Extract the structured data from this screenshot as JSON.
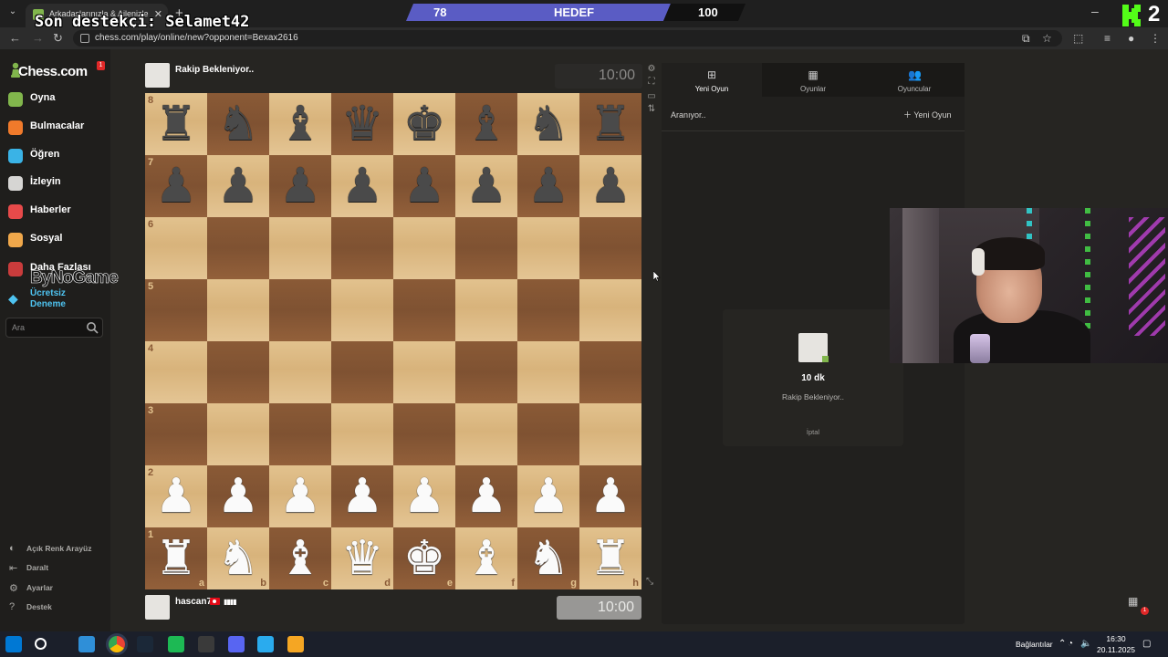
{
  "browser": {
    "tab_title": "Arkadaşlarınızla & Ailenizle Üc",
    "url": "chess.com/play/online/new?opponent=Bexax2616"
  },
  "stream_overlay": {
    "support_text": "Son destekçi: Selamet42",
    "goal_current": "78",
    "goal_label": "HEDEF",
    "goal_target": "100",
    "goal_progress": 0.78,
    "corner_number": "2"
  },
  "sidebar": {
    "logo": "Chess.com",
    "notification_count": "1",
    "items": [
      {
        "label": "Oyna",
        "icon": "pawn-play-icon",
        "color": "#81b64c"
      },
      {
        "label": "Bulmacalar",
        "icon": "puzzle-icon",
        "color": "#f07a2b"
      },
      {
        "label": "Öğren",
        "icon": "learn-icon",
        "color": "#3ab3e6"
      },
      {
        "label": "İzleyin",
        "icon": "binoculars-icon",
        "color": "#d6d5d3"
      },
      {
        "label": "Haberler",
        "icon": "news-icon",
        "color": "#e74a4a"
      },
      {
        "label": "Sosyal",
        "icon": "social-icon",
        "color": "#f0a84b"
      },
      {
        "label": "Daha Fazlası",
        "icon": "more-icon",
        "color": "#c93c3c"
      }
    ],
    "watermark": "ByNoGame",
    "trial_label": "Ücretsiz Deneme",
    "search_placeholder": "Ara",
    "bottom_items": [
      {
        "label": "Açık Renk Arayüz",
        "icon": "theme-toggle-icon"
      },
      {
        "label": "Daralt",
        "icon": "collapse-icon"
      },
      {
        "label": "Ayarlar",
        "icon": "settings-icon"
      },
      {
        "label": "Destek",
        "icon": "help-icon"
      }
    ]
  },
  "game": {
    "top_player": {
      "name": "Rakip Bekleniyor..",
      "clock": "10:00"
    },
    "bottom_player": {
      "name": "hascan7",
      "flag": "TR",
      "clock": "10:00"
    },
    "ranks": [
      "8",
      "7",
      "6",
      "5",
      "4",
      "3",
      "2",
      "1"
    ],
    "files": [
      "a",
      "b",
      "c",
      "d",
      "e",
      "f",
      "g",
      "h"
    ],
    "position": [
      [
        "br",
        "bn",
        "bb",
        "bq",
        "bk",
        "bb",
        "bn",
        "br"
      ],
      [
        "bp",
        "bp",
        "bp",
        "bp",
        "bp",
        "bp",
        "bp",
        "bp"
      ],
      [
        "",
        "",
        "",
        "",
        "",
        "",
        "",
        ""
      ],
      [
        "",
        "",
        "",
        "",
        "",
        "",
        "",
        ""
      ],
      [
        "",
        "",
        "",
        "",
        "",
        "",
        "",
        ""
      ],
      [
        "",
        "",
        "",
        "",
        "",
        "",
        "",
        ""
      ],
      [
        "wp",
        "wp",
        "wp",
        "wp",
        "wp",
        "wp",
        "wp",
        "wp"
      ],
      [
        "wr",
        "wn",
        "wb",
        "wq",
        "wk",
        "wb",
        "wn",
        "wr"
      ]
    ],
    "board_colors": {
      "light": "#dfbf8a",
      "dark": "#8a5a36"
    }
  },
  "panel": {
    "tabs": [
      {
        "label": "Yeni Oyun",
        "icon": "plus-icon",
        "active": true
      },
      {
        "label": "Oyunlar",
        "icon": "board-icon",
        "active": false
      },
      {
        "label": "Oyuncular",
        "icon": "players-icon",
        "active": false
      }
    ],
    "searching_text": "Aranıyor..",
    "new_game_link": "Yeni Oyun",
    "seek": {
      "time": "10 dk",
      "status": "Rakip Bekleniyor..",
      "cancel": "İptal"
    }
  },
  "taskbar": {
    "connections": "Bağlantılar",
    "time": "16:30",
    "date": "20.11.2025",
    "apps": [
      "windows-start-icon",
      "search-icon",
      "file-explorer-icon",
      "chrome-icon",
      "steam-icon",
      "spotify-icon",
      "obs-icon",
      "discord-icon",
      "telegram-icon",
      "unknown-app-icon"
    ]
  },
  "floating_badge": "1"
}
